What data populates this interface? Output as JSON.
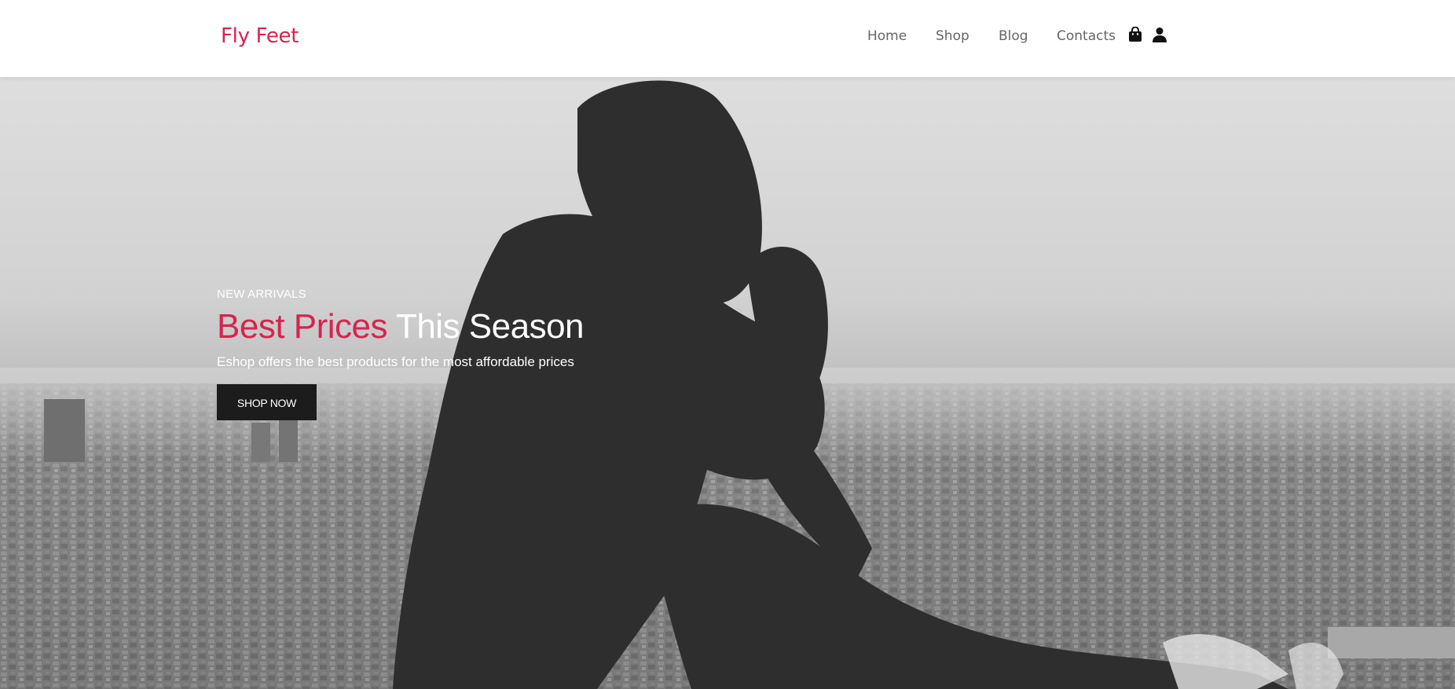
{
  "header": {
    "brand": "Fly Feet",
    "nav": [
      {
        "label": "Home"
      },
      {
        "label": "Shop"
      },
      {
        "label": "Blog"
      },
      {
        "label": "Contacts"
      }
    ],
    "icons": {
      "cart": "shopping-bag-icon",
      "account": "user-icon"
    }
  },
  "hero": {
    "eyebrow": "NEW ARRIVALS",
    "headline_accent": "Best Prices",
    "headline_plain": "This Season",
    "subline": "Eshop offers the best products for the most affordable prices",
    "cta_label": "SHOP NOW"
  },
  "colors": {
    "brand": "#d6244f",
    "cta_bg": "#1c1c1c",
    "nav_text": "#666666"
  }
}
